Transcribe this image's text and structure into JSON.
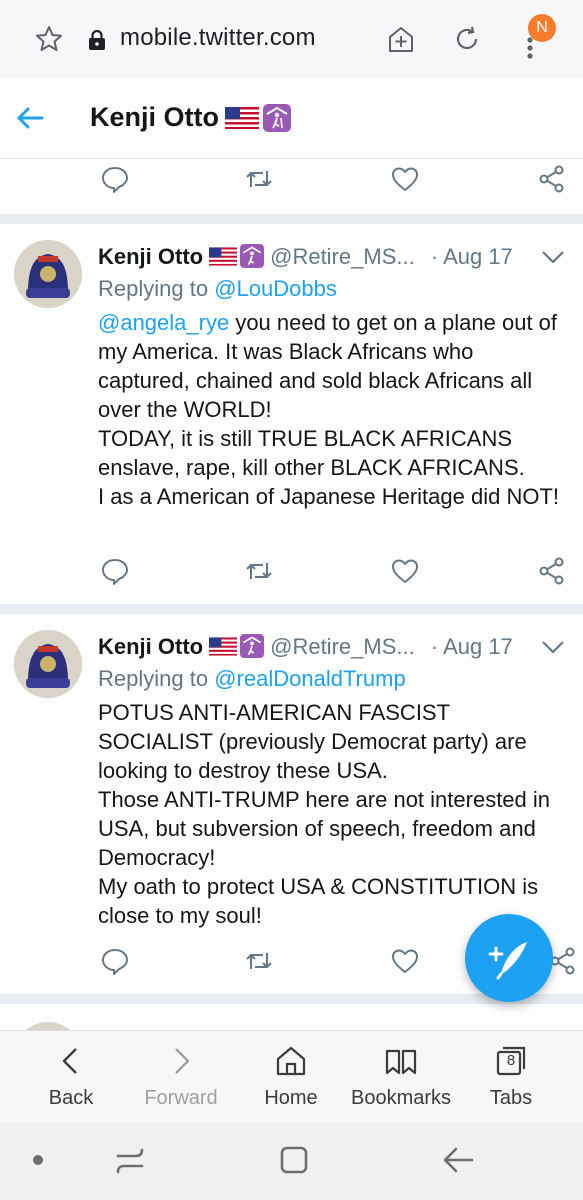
{
  "browser": {
    "url": "mobile.twitter.com",
    "profile_initial": "N",
    "accent": "#f57c2a"
  },
  "header": {
    "title": "Kenji Otto"
  },
  "tweets": [
    {
      "name": "Kenji Otto",
      "handle": "@Retire_MS...",
      "sep": "·",
      "date": "Aug 17",
      "replying_prefix": "Replying to",
      "replying_to": "@LouDobbs",
      "mention": "@angela_rye",
      "lines": [
        " you need to get on a plane out of my America. It was Black Africans who captured, chained and sold black Africans all over the WORLD!",
        "TODAY, it is still TRUE BLACK AFRICANS enslave, rape, kill other BLACK AFRICANS.",
        "I as a American of Japanese Heritage did NOT!"
      ]
    },
    {
      "name": "Kenji Otto",
      "handle": "@Retire_MS...",
      "sep": "·",
      "date": "Aug 17",
      "replying_prefix": "Replying to",
      "replying_to": "@realDonaldTrump",
      "lines": [
        "POTUS ANTI-AMERICAN FASCIST SOCIALIST (previously Democrat party) are looking to destroy these USA.",
        "Those ANTI-TRUMP here are not interested in USA, but subversion of speech, freedom and Democracy!",
        "My oath to protect USA & CONSTITUTION is close to my soul!"
      ]
    }
  ],
  "bottom_nav": {
    "back": "Back",
    "forward": "Forward",
    "home": "Home",
    "bookmarks": "Bookmarks",
    "tabs": "Tabs",
    "tab_count": "8"
  },
  "colors": {
    "twitter_blue": "#1da1f2",
    "muted": "#657786"
  },
  "icons": [
    "star-icon",
    "lock-icon",
    "add-tab-icon",
    "reload-icon",
    "more-icon",
    "back-arrow-icon",
    "reply-icon",
    "retweet-icon",
    "like-icon",
    "share-icon",
    "chevron-down-icon",
    "compose-icon"
  ]
}
